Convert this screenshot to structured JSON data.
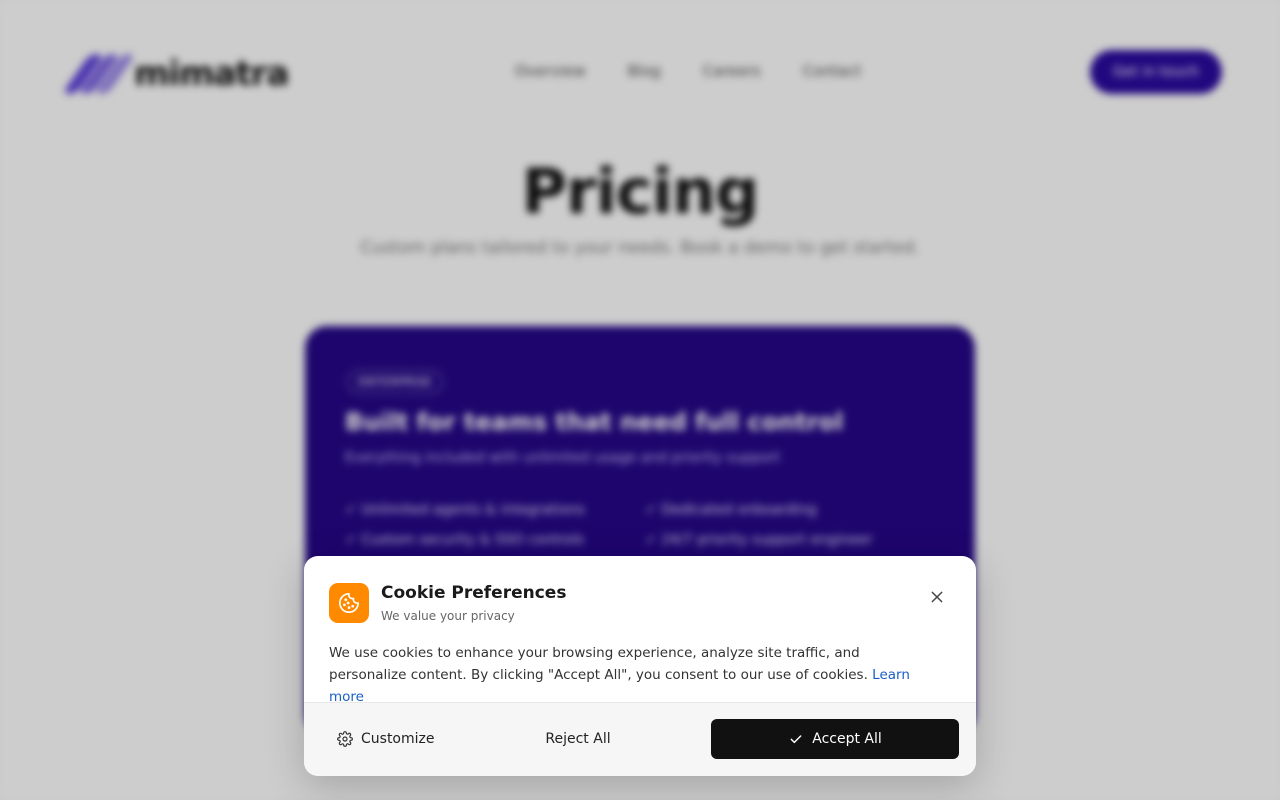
{
  "background": {
    "logo_text": "mimatra",
    "nav_links": [
      "Overview",
      "Blog",
      "Careers",
      "Contact"
    ],
    "nav_cta": "Get in touch",
    "hero_title": "Pricing",
    "hero_subtitle": "Custom plans tailored to your needs. Book a demo to get started.",
    "plan": {
      "badge": "ENTERPRISE",
      "title": "Built for teams that need full control",
      "subtitle": "Everything included with unlimited usage and priority support",
      "features": [
        "Unlimited agents & integrations",
        "Dedicated onboarding",
        "Custom security & SSO controls",
        "24/7 priority support engineer"
      ]
    },
    "colors": {
      "brand": "#2a0a9c",
      "card": "#240785"
    }
  },
  "dialog": {
    "icon": "cookie-icon",
    "title": "Cookie Preferences",
    "subtitle": "We value your privacy",
    "body": "We use cookies to enhance your browsing experience, analyze site traffic, and personalize content. By clicking \"Accept All\", you consent to our use of cookies.",
    "link": "Learn more",
    "close_icon": "close-icon",
    "buttons": {
      "customize": "Customize",
      "reject": "Reject All",
      "accept": "Accept All"
    },
    "colors": {
      "icon_bg": "#ff8a00",
      "link": "#1a5fc7",
      "accept_bg": "#111111"
    }
  }
}
